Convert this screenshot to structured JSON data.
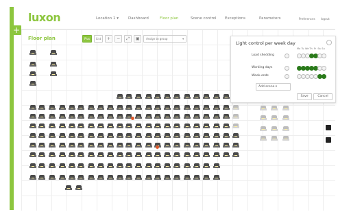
{
  "app": {
    "logo": "luxon"
  },
  "topnav": {
    "items": [
      "Location 1 ▾",
      "Dashboard",
      "Floor plan",
      "Scene control",
      "Exceptions",
      "Parameters"
    ],
    "active_index": 2,
    "prefs": "Preferences",
    "logout": "logout"
  },
  "page": {
    "title": "Floor plan"
  },
  "toolbar": {
    "tab_plus": "Plus",
    "tab_list": "List",
    "select_placeholder": "Assign to group"
  },
  "panel": {
    "title": "Light control per week day",
    "days": [
      "Mo",
      "Tu",
      "We",
      "Th",
      "Fr",
      "Sa",
      "Su"
    ],
    "rows": [
      {
        "label": "Load shedding",
        "states": [
          0,
          0,
          0,
          1,
          1,
          0,
          0
        ]
      },
      {
        "label": "Working days",
        "states": [
          1,
          1,
          1,
          1,
          1,
          0,
          0
        ]
      },
      {
        "label": "Week-ends",
        "states": [
          0,
          0,
          0,
          0,
          0,
          1,
          1
        ]
      }
    ],
    "add_scene": "Add scene",
    "save": "Save",
    "cancel": "Cancel"
  },
  "colors": {
    "accent": "#8dc63f",
    "on": "#2a7a1a",
    "alert": "#e05a2c"
  }
}
